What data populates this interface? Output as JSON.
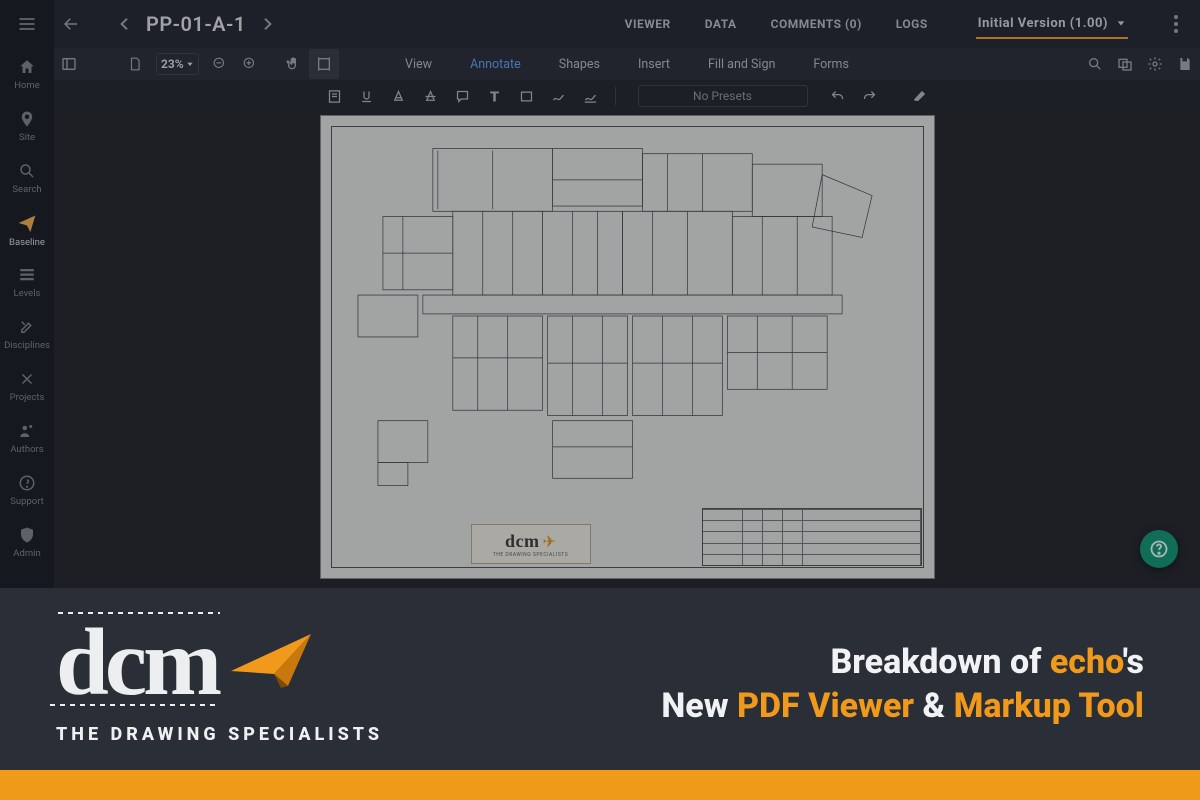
{
  "rail": {
    "items": [
      {
        "label": "Home",
        "icon": "home"
      },
      {
        "label": "Site",
        "icon": "pin"
      },
      {
        "label": "Search",
        "icon": "search"
      },
      {
        "label": "Baseline",
        "icon": "plane",
        "active": true
      },
      {
        "label": "Levels",
        "icon": "levels"
      },
      {
        "label": "Disciplines",
        "icon": "tools"
      },
      {
        "label": "Projects",
        "icon": "tools2"
      },
      {
        "label": "Authors",
        "icon": "authors"
      },
      {
        "label": "Support",
        "icon": "support"
      },
      {
        "label": "Admin",
        "icon": "shield"
      }
    ]
  },
  "top": {
    "doc_title": "PP-01-A-1",
    "tabs": [
      "VIEWER",
      "DATA",
      "COMMENTS (0)",
      "LOGS"
    ],
    "version_label": "Initial Version (1.00)"
  },
  "viewer_toolbar": {
    "zoom": "23%",
    "menu": [
      "View",
      "Annotate",
      "Shapes",
      "Insert",
      "Fill and Sign",
      "Forms"
    ],
    "active_menu": "Annotate",
    "presets_label": "No Presets"
  },
  "fab": {
    "label": "?"
  },
  "promo": {
    "logo_text": "dcm",
    "tagline": "THE DRAWING SPECIALISTS",
    "line1_a": "Breakdown of ",
    "line1_b": "echo",
    "line1_c": "'s",
    "line2_a": "New ",
    "line2_b": "PDF Viewer",
    "line2_c": " & ",
    "line2_d": "Markup Tool"
  },
  "stamp": {
    "brand": "dcm",
    "sub": "THE DRAWING SPECIALISTS"
  }
}
